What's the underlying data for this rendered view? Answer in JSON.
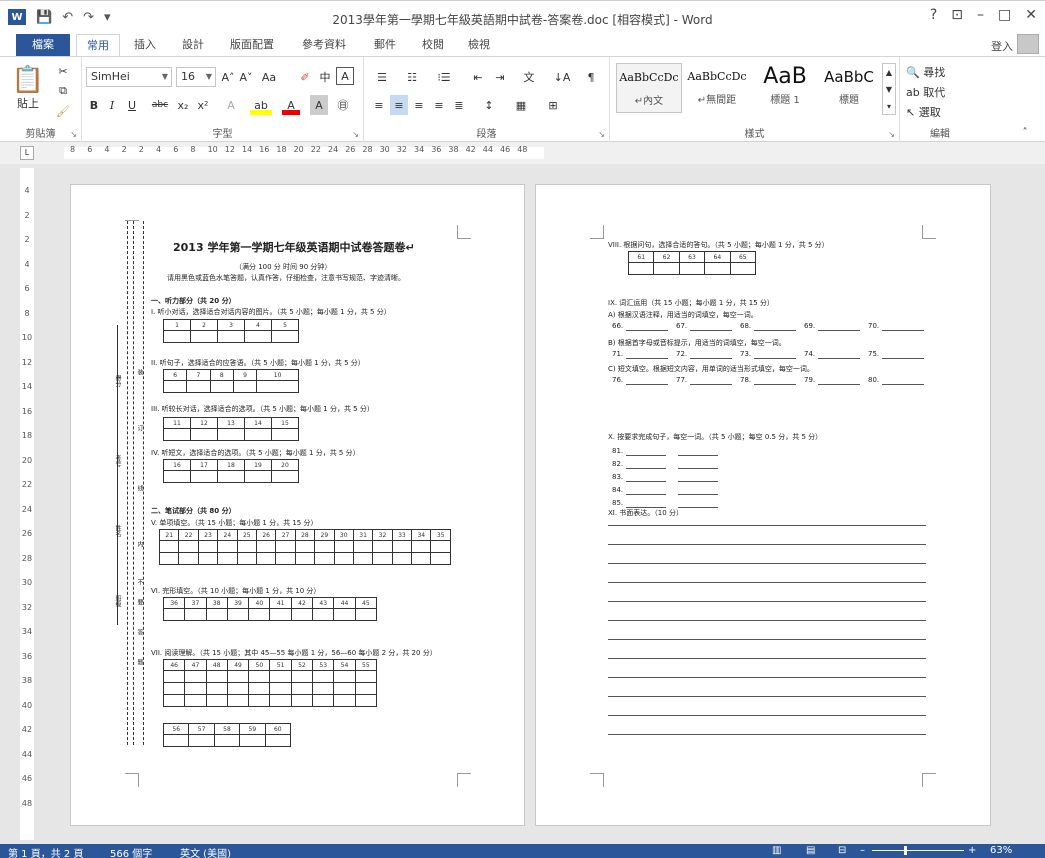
{
  "window": {
    "title": "2013學年第一學期七年級英語期中試卷-答案卷.doc [相容模式] - Word",
    "controls": {
      "help": "?",
      "ribbon_opts": "⊡",
      "minimize": "–",
      "restore": "□",
      "close": "✕"
    },
    "qa": {
      "save": "💾",
      "undo": "↶",
      "redo": "↷",
      "more": "▾"
    }
  },
  "tabs": [
    "檔案",
    "常用",
    "插入",
    "設計",
    "版面配置",
    "參考資料",
    "郵件",
    "校閱",
    "檢視"
  ],
  "signin": "登入",
  "ribbon": {
    "clipboard": {
      "paste": "貼上",
      "label": "剪貼簿"
    },
    "font": {
      "name": "SimHei",
      "size": "16",
      "label": "字型",
      "grow": "A˄",
      "shrink": "A˅",
      "case": "Aa",
      "clear": "✐",
      "phonetic": "中",
      "boxed": "A",
      "bold": "B",
      "italic": "I",
      "underline": "U",
      "strike": "abc",
      "sub": "x₂",
      "sup": "x²",
      "effects": "A",
      "highlight": "ab",
      "color": "A",
      "shade": "A",
      "enclosed": "㊐"
    },
    "paragraph": {
      "label": "段落",
      "bullets": "☰",
      "numbering": "☷",
      "multilevel": "⁝☰",
      "outdent": "⇤",
      "indent": "⇥",
      "asian": "文",
      "sort": "↓A",
      "marks": "¶",
      "al": "≡",
      "ac": "≡",
      "ar": "≡",
      "aj": "≡",
      "dist": "≣",
      "spacing": "↕",
      "shade": "▦",
      "border": "⊞"
    },
    "styles": {
      "label": "樣式",
      "items": [
        {
          "sample": "AaBbCcDc",
          "name": "↵內文"
        },
        {
          "sample": "AaBbCcDc",
          "name": "↵無間距"
        },
        {
          "sample": "AaB",
          "name": "標題 1"
        },
        {
          "sample": "AaBbC",
          "name": "標題"
        }
      ]
    },
    "editing": {
      "label": "編輯",
      "find": "尋找",
      "replace": "取代",
      "select": "選取"
    }
  },
  "ruler": {
    "marker": "L",
    "nums": [
      "8",
      "6",
      "4",
      "2",
      "2",
      "4",
      "6",
      "8",
      "10",
      "12",
      "14",
      "16",
      "18",
      "20",
      "22",
      "24",
      "26",
      "28",
      "30",
      "32",
      "34",
      "36",
      "38",
      "42",
      "44",
      "46",
      "48"
    ],
    "vnums": [
      "4",
      "2",
      "2",
      "4",
      "6",
      "8",
      "10",
      "12",
      "14",
      "16",
      "18",
      "20",
      "22",
      "24",
      "26",
      "28",
      "30",
      "32",
      "34",
      "36",
      "38",
      "40",
      "42",
      "44",
      "46",
      "48"
    ]
  },
  "page1": {
    "title": "2013 学年第一学期七年级英语期中试卷答题卷↵",
    "sub": "（满分 100 分      时间 90 分钟）",
    "note": "请用黑色或蓝色水笔答题，认真作答，仔细检查，注意书写规范、字迹清晰。",
    "part1": "一、听力部分（共 20 分）",
    "q1": "I. 听小对话，选择适合对话内容的图片。（共 5 小题；每小题 1 分，共 5 分）",
    "q2": "II. 听句子，选择适合的应答语。（共 5 小题；每小题 1 分，共 5 分）",
    "q3": "III. 听较长对话，选择适合的选项。（共 5 小题；每小题 1 分，共 5 分）",
    "q4": "IV. 听短文，选择适合的选项。（共 5 小题；每小题 1 分，共 5 分）",
    "part2": "二、笔试部分（共 80 分）",
    "q5": "V. 单项填空。（共 15 小题；每小题 1 分，共 15 分）",
    "q6": "VI. 完形填空。（共 10 小题；每小题 1 分，共 10 分）",
    "q7": "VII. 阅读理解。（共 15 小题；其中 45—55 每小题 1 分，56—60 每小题 2 分，共 20 分）",
    "g1": [
      "1",
      "2",
      "3",
      "4",
      "5"
    ],
    "g2": [
      "6",
      "7",
      "8",
      "9",
      "10"
    ],
    "g3": [
      "11",
      "12",
      "13",
      "14",
      "15"
    ],
    "g4": [
      "16",
      "17",
      "18",
      "19",
      "20"
    ],
    "g5": [
      "21",
      "22",
      "23",
      "24",
      "25",
      "26",
      "27",
      "28",
      "29",
      "30",
      "31",
      "32",
      "33",
      "34",
      "35"
    ],
    "g6": [
      "36",
      "37",
      "38",
      "39",
      "40",
      "41",
      "42",
      "43",
      "44",
      "45"
    ],
    "g7": [
      "46",
      "47",
      "48",
      "49",
      "50",
      "51",
      "52",
      "53",
      "54",
      "55"
    ],
    "g8": [
      "56",
      "57",
      "58",
      "59",
      "60"
    ],
    "side": {
      "a": "得分",
      "b": "考号",
      "c": "姓名",
      "d": "班级",
      "e": "装",
      "f": "订",
      "g": "线",
      "h": "内",
      "i": "不",
      "j": "要",
      "k": "答",
      "l": "题"
    }
  },
  "page2": {
    "q8": "VIII. 根据问句，选择合适的答句。（共 5 小题；每小题 1 分，共 5 分）",
    "g9": [
      "61",
      "62",
      "63",
      "64",
      "65"
    ],
    "q9": "IX. 词汇运用（共 15 小题；每小题 1 分，共 15 分）",
    "q9a": "A) 根据汉语注释，用适当的词填空，每空一词。",
    "q9b": "B) 根据首字母或音标提示，用适当的词填空，每空一词。",
    "q9c": "C) 短文填空。根据短文内容，用单词的适当形式填空，每空一词。",
    "rowA": [
      "66.",
      "67.",
      "68.",
      "69.",
      "70."
    ],
    "rowB": [
      "71.",
      "72.",
      "73.",
      "74.",
      "75."
    ],
    "rowC": [
      "76.",
      "77.",
      "78.",
      "79.",
      "80."
    ],
    "q10": "X. 按要求完成句子，每空一词。（共 5 小题；每空 0.5 分，共 5 分）",
    "rowX": [
      "81.",
      "82.",
      "83.",
      "84.",
      "85."
    ],
    "q11": "XI. 书面表达。（10 分）"
  },
  "status": {
    "page": "第 1 頁，共 2 頁",
    "words": "566 個字",
    "lang": "英文 (美國)",
    "zoom": "63%",
    "minus": "–",
    "plus": "+"
  }
}
